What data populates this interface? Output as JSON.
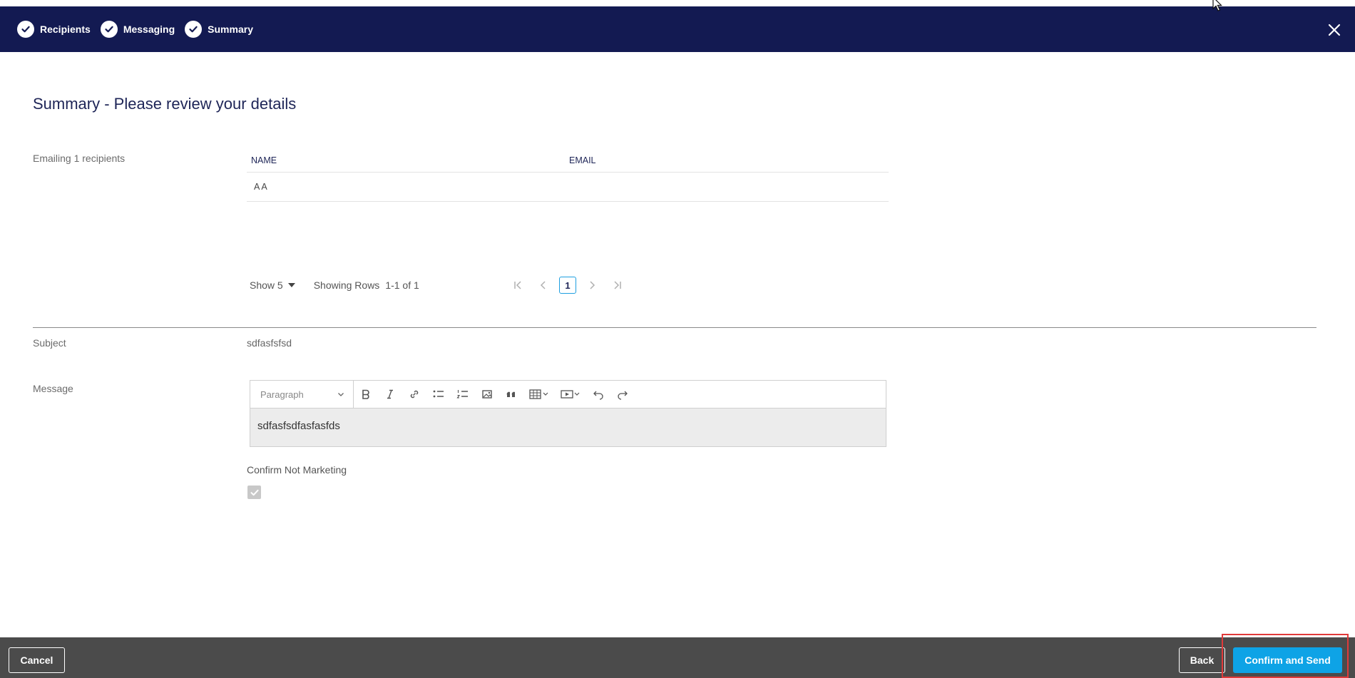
{
  "wizard": {
    "steps": [
      {
        "label": "Recipients"
      },
      {
        "label": "Messaging"
      },
      {
        "label": "Summary"
      }
    ]
  },
  "page": {
    "title": "Summary - Please review your details"
  },
  "recipients": {
    "label": "Emailing 1 recipients",
    "columns": {
      "name": "NAME",
      "email": "EMAIL"
    },
    "rows": [
      {
        "name": "A A",
        "email": ""
      }
    ]
  },
  "pagination": {
    "show_label": "Show 5",
    "showing_rows": "Showing Rows",
    "range": "1-1 of 1",
    "current_page": "1"
  },
  "subject": {
    "label": "Subject",
    "value": "sdfasfsfsd"
  },
  "message": {
    "label": "Message",
    "format_select": "Paragraph",
    "body": "sdfasfsdfasfasfds"
  },
  "marketing": {
    "label": "Confirm Not Marketing",
    "checked": true
  },
  "footer": {
    "cancel_label": "Cancel",
    "back_label": "Back",
    "confirm_label": "Confirm and Send"
  },
  "colors": {
    "header_bg": "#131a52",
    "footer_bg": "#4b4b4b",
    "primary": "#0ea3e6",
    "highlight": "#e03a3a"
  }
}
